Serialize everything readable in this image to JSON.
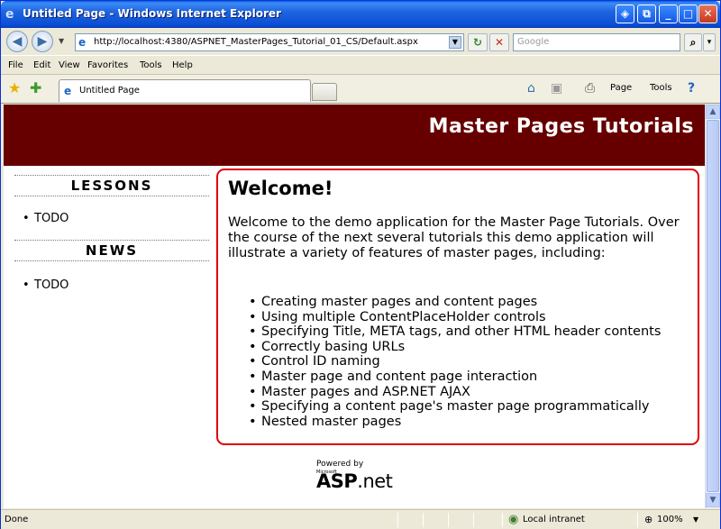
{
  "window": {
    "title": "Untitled Page - Windows Internet Explorer",
    "icon": "ie-icon",
    "controls": {
      "extra": "◈",
      "minimize": "_",
      "maximize": "□",
      "close": "✕"
    }
  },
  "toolbar": {
    "back": "◀",
    "forward": "▶",
    "address": "http://localhost:4380/ASPNET_MasterPages_Tutorial_01_CS/Default.aspx",
    "refresh": "↻",
    "stop": "✕",
    "search_placeholder": "Google",
    "search_button": "⌕",
    "search_drop": "▾"
  },
  "menu": {
    "items": [
      "File",
      "Edit",
      "View",
      "Favorites",
      "Tools",
      "Help"
    ]
  },
  "tabs": {
    "active_label": "Untitled Page",
    "commands": {
      "home": "⌂",
      "feeds": "▣",
      "print": "⎙",
      "page": "Page",
      "tools": "Tools",
      "help": "?"
    }
  },
  "page": {
    "header_title": "Master Pages Tutorials",
    "lessons": {
      "title": "LESSONS",
      "items": [
        "TODO"
      ]
    },
    "news": {
      "title": "NEWS",
      "items": [
        "TODO"
      ]
    },
    "welcome": "Welcome!",
    "intro": "Welcome to the demo application for the Master Page Tutorials. Over the course of the next several tutorials this demo application will illustrate a variety of features of master pages, including:",
    "features": [
      "Creating master pages and content pages",
      "Using multiple ContentPlaceHolder controls",
      "Specifying Title, META tags, and other HTML header contents",
      "Correctly basing URLs",
      "Control ID naming",
      "Master page and content page interaction",
      "Master pages and ASP.NET AJAX",
      "Specifying a content page's master page programmatically",
      "Nested master pages"
    ],
    "powered_by": "Powered by",
    "powered_ms": "Microsoft",
    "powered_logo_asp": "ASP",
    "powered_logo_net": ".net"
  },
  "status": {
    "text": "Done",
    "zone": "Local intranet",
    "zoom": "100%"
  },
  "colors": {
    "header_bg": "#660000",
    "content_border": "#E00000",
    "titlebar": "#0A5FE0"
  }
}
